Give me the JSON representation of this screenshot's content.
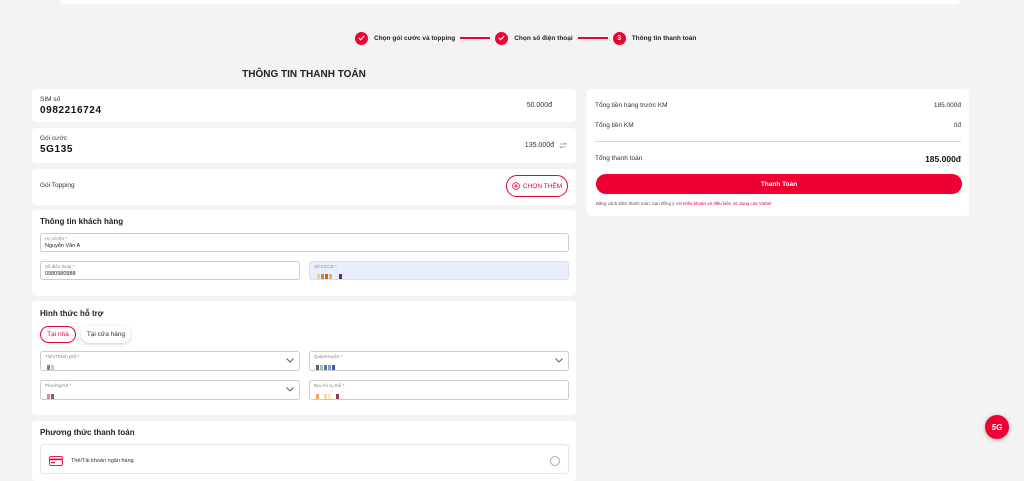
{
  "stepper": {
    "steps": [
      {
        "label": "Chọn gói cước và topping",
        "status": "done"
      },
      {
        "label": "Chọn số điện thoại",
        "status": "done"
      },
      {
        "label": "Thông tin thanh toán",
        "status": "current",
        "number": "3"
      }
    ]
  },
  "page": {
    "title": "THÔNG TIN THANH TOÁN"
  },
  "sim": {
    "label": "SIM số",
    "number": "0982216724",
    "price": "50.000đ"
  },
  "package": {
    "label": "Gói cước",
    "name": "5G135",
    "price": "135.000đ"
  },
  "topping": {
    "label": "Gói Topping",
    "button_label": "CHỌN THÊM"
  },
  "customer": {
    "title": "Thông tin khách hàng",
    "name_label": "Họ và tên *",
    "name_value": "Nguyễn Văn A",
    "phone_label": "Số điện thoại *",
    "phone_value": "0980980988",
    "id_label": "Số CCCD *"
  },
  "support": {
    "title": "Hình thức hỗ trợ",
    "option_home": "Tại nhà",
    "option_store": "Tại cửa hàng",
    "province_label": "Tỉnh/Thành phố *",
    "district_label": "Quận/Huyện *",
    "ward_label": "Phường/Xã *",
    "address_label": "Địa chỉ cụ thể *"
  },
  "payment": {
    "title": "Phương thức thanh toán",
    "option_card": "Thẻ/Tài khoản ngân hàng"
  },
  "summary": {
    "subtotal_label": "Tổng tiền hàng trước KM",
    "subtotal_value": "185.000đ",
    "discount_label": "Tổng tiền KM",
    "discount_value": "0đ",
    "total_label": "Tổng thanh toán",
    "total_value": "185.000đ",
    "pay_button": "Thanh Toán",
    "terms_text": "Bằng cách bấm thanh toán, bạn đồng ý với",
    "terms_link": "Điều khoản và điều kiện sử dụng của Viettel"
  },
  "badge": {
    "text": "5G"
  },
  "colors": {
    "accent": "#ee0033",
    "background": "#f3f3f3",
    "card": "#ffffff"
  }
}
